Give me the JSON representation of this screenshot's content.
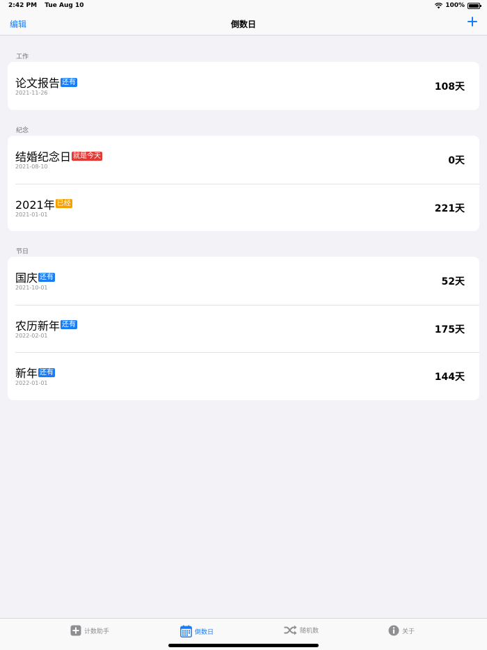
{
  "status_bar": {
    "time": "2:42 PM",
    "date": "Tue Aug 10",
    "battery": "100%"
  },
  "nav": {
    "edit_label": "编辑",
    "title": "倒数日",
    "add_icon": "plus-icon"
  },
  "colors": {
    "accent": "#1a7cf5",
    "badge_remaining": "#1a7cf5",
    "badge_today": "#e53935",
    "badge_passed": "#f5a000"
  },
  "sections": [
    {
      "header": "工作",
      "items": [
        {
          "name": "论文报告",
          "badge": "还有",
          "badge_type": "remaining",
          "date": "2021-11-26",
          "days": "108天"
        }
      ]
    },
    {
      "header": "纪念",
      "items": [
        {
          "name": "结婚纪念日",
          "badge": "就是今天",
          "badge_type": "today",
          "date": "2021-08-10",
          "days": "0天"
        },
        {
          "name": "2021年",
          "badge": "已经",
          "badge_type": "passed",
          "date": "2021-01-01",
          "days": "221天"
        }
      ]
    },
    {
      "header": "节日",
      "items": [
        {
          "name": "国庆",
          "badge": "还有",
          "badge_type": "remaining",
          "date": "2021-10-01",
          "days": "52天"
        },
        {
          "name": "农历新年",
          "badge": "还有",
          "badge_type": "remaining",
          "date": "2022-02-01",
          "days": "175天"
        },
        {
          "name": "新年",
          "badge": "还有",
          "badge_type": "remaining",
          "date": "2022-01-01",
          "days": "144天"
        }
      ]
    }
  ],
  "tabs": [
    {
      "label": "计数助手",
      "icon": "plus-square-icon",
      "active": false
    },
    {
      "label": "倒数日",
      "icon": "calendar-icon",
      "active": true
    },
    {
      "label": "随机数",
      "icon": "shuffle-icon",
      "active": false
    },
    {
      "label": "关于",
      "icon": "info-icon",
      "active": false
    }
  ]
}
